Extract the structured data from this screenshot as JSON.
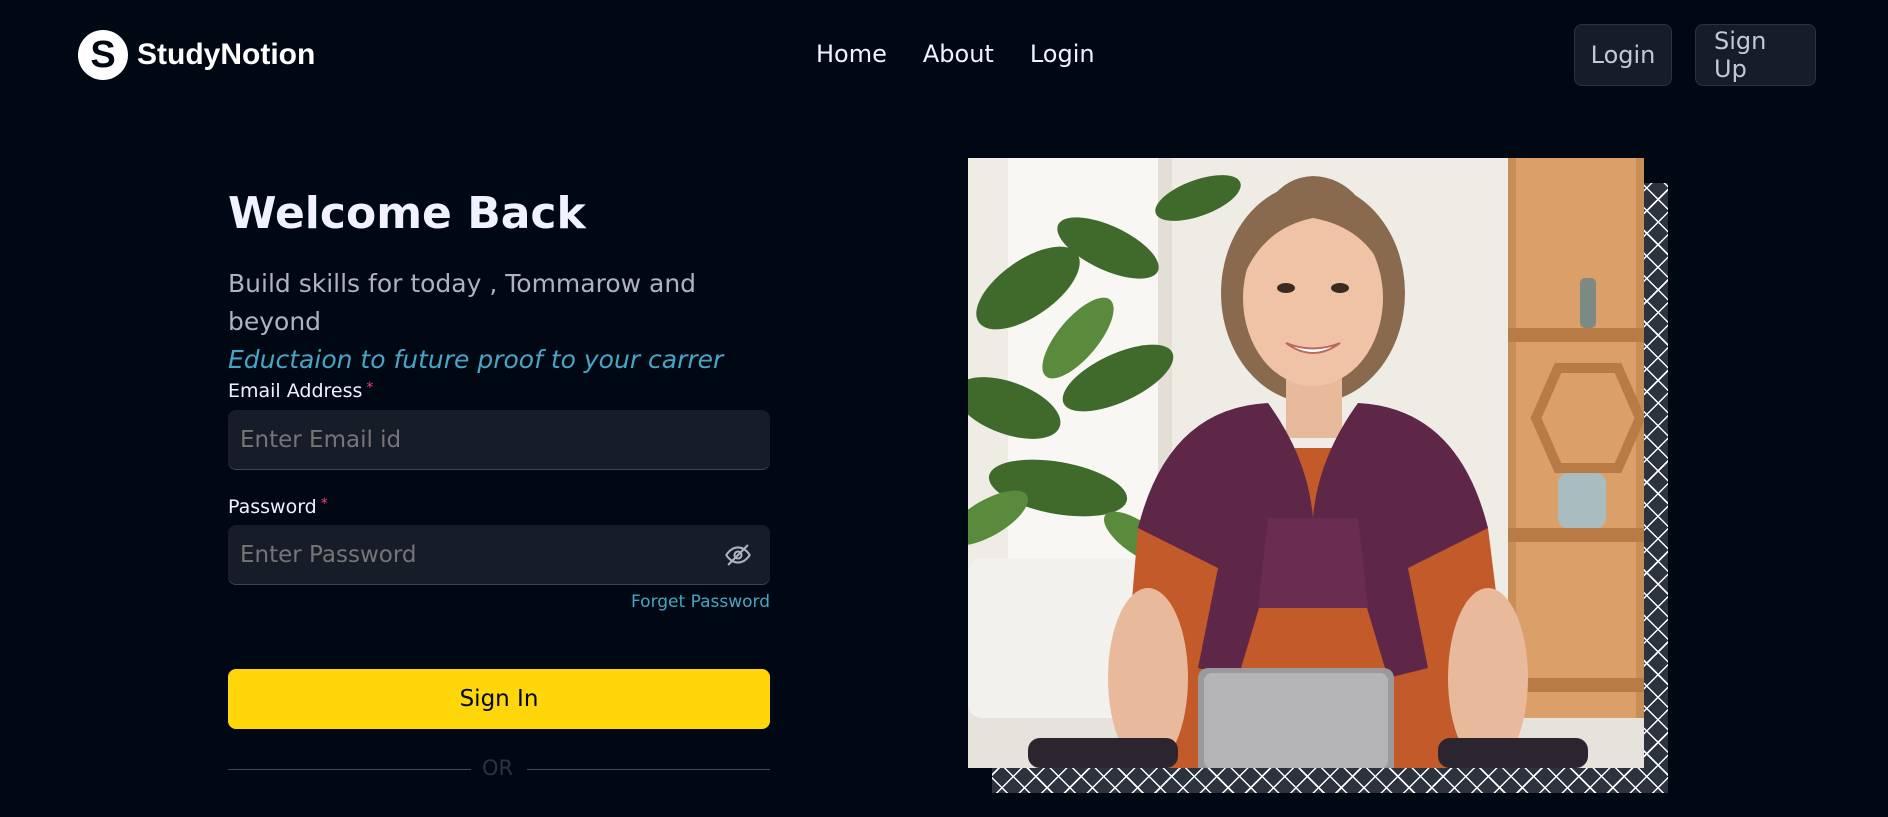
{
  "brand": {
    "name": "StudyNotion",
    "logo_letter": "S"
  },
  "nav": {
    "links": [
      "Home",
      "About",
      "Login"
    ],
    "login_button": "Login",
    "signup_button": "Sign Up"
  },
  "form": {
    "title": "Welcome Back",
    "subtitle": "Build skills for today , Tommarow and beyond",
    "subtitle_highlight": "Eductaion to future proof to your carrer",
    "email_label": "Email Address",
    "email_placeholder": "Enter Email id",
    "password_label": "Password",
    "password_placeholder": "Enter Password",
    "required_mark": "*",
    "forget_password": "Forget Password",
    "signin_button": "Sign In",
    "divider_text": "OR"
  },
  "icons": {
    "password_toggle": "eye-slash-icon"
  },
  "colors": {
    "background": "#000814",
    "accent_yellow": "#FFD60A",
    "link_blue": "#47A5C5",
    "input_bg": "#161D29",
    "required_red": "#EF476F"
  }
}
